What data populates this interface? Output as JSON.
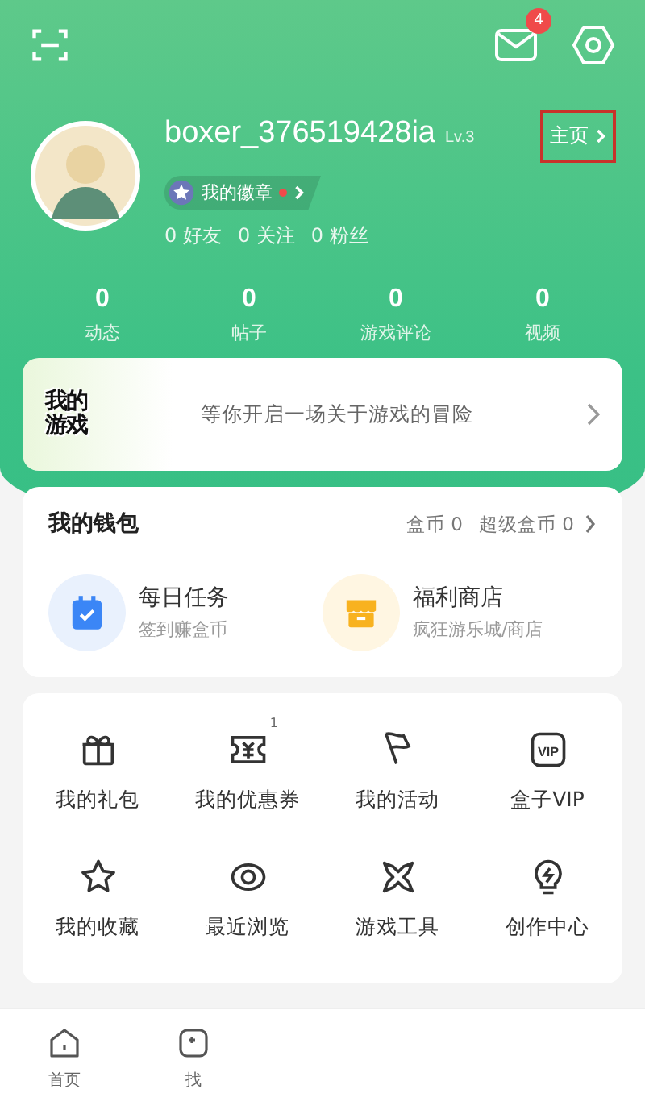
{
  "header": {
    "message_count": "4"
  },
  "profile": {
    "username": "boxer_376519428ia",
    "level": "Lv.3",
    "home_link": {
      "label": "主页",
      "highlighted": true
    },
    "badge": {
      "label": "我的徽章",
      "new_dot": true
    },
    "social": [
      {
        "count": "0",
        "label": "好友"
      },
      {
        "count": "0",
        "label": "关注"
      },
      {
        "count": "0",
        "label": "粉丝"
      }
    ]
  },
  "stats": [
    {
      "value": "0",
      "label": "动态"
    },
    {
      "value": "0",
      "label": "帖子"
    },
    {
      "value": "0",
      "label": "游戏评论"
    },
    {
      "value": "0",
      "label": "视频"
    }
  ],
  "banner": {
    "logo_lines": [
      "我的",
      "游戏"
    ],
    "text": "等你开启一场关于游戏的冒险"
  },
  "wallet": {
    "title": "我的钱包",
    "balances": [
      {
        "label": "盒币",
        "value": "0"
      },
      {
        "label": "超级盒币",
        "value": "0"
      }
    ],
    "items": [
      {
        "kind": "task",
        "title": "每日任务",
        "subtitle": "签到赚盒币"
      },
      {
        "kind": "shop",
        "title": "福利商店",
        "subtitle": "疯狂游乐城/商店"
      }
    ]
  },
  "shortcuts": [
    {
      "kind": "gift",
      "label": "我的礼包"
    },
    {
      "kind": "coupon",
      "label": "我的优惠券",
      "badge": "1"
    },
    {
      "kind": "flag",
      "label": "我的活动"
    },
    {
      "kind": "vip",
      "label": "盒子VIP",
      "icon_text": "VIP"
    },
    {
      "kind": "star",
      "label": "我的收藏"
    },
    {
      "kind": "eye",
      "label": "最近浏览"
    },
    {
      "kind": "tools",
      "label": "游戏工具"
    },
    {
      "kind": "bulb",
      "label": "创作中心"
    }
  ],
  "tab_bar": [
    {
      "kind": "home",
      "label": "首页"
    },
    {
      "kind": "find",
      "label": "找"
    }
  ]
}
